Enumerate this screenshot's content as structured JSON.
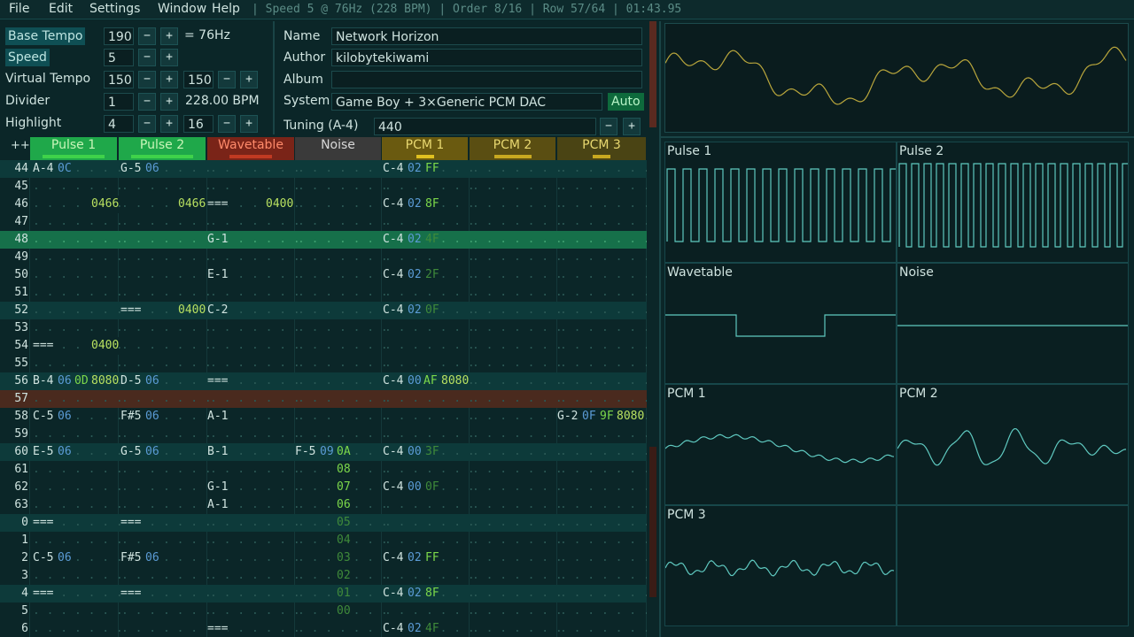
{
  "menu": {
    "items": [
      "File",
      "Edit",
      "Settings",
      "Window",
      "Help"
    ],
    "status": "| Speed 5 @ 76Hz (228 BPM) | Order 8/16 | Row 57/64 | 01:43.95"
  },
  "speed_panel": {
    "base_tempo_label": "Base Tempo",
    "base_tempo_value": "190",
    "base_tempo_hz": "= 76Hz",
    "speed_label": "Speed",
    "speed_value": "5",
    "virtual_tempo_label": "Virtual Tempo",
    "virtual_tempo_num": "150",
    "virtual_tempo_den": "150",
    "divider_label": "Divider",
    "divider_value": "1",
    "bpm": "228.00 BPM",
    "highlight_label": "Highlight",
    "highlight_a": "4",
    "highlight_b": "16",
    "minus": "−",
    "plus": "+"
  },
  "song_info": {
    "name_label": "Name",
    "name_value": "Network Horizon",
    "author_label": "Author",
    "author_value": "kilobytekiwami",
    "album_label": "Album",
    "album_value": "",
    "system_label": "System",
    "system_value": "Game Boy + 3×Generic PCM DAC",
    "auto_label": "Auto",
    "tuning_label": "Tuning (A-4)",
    "tuning_value": "440"
  },
  "channels": [
    {
      "name": "Pulse 1",
      "color": "#1fa84a",
      "bar": "#3fd24a"
    },
    {
      "name": "Pulse 2",
      "color": "#1fa84a",
      "bar": "#3fd24a"
    },
    {
      "name": "Wavetable",
      "color": "#7a2418",
      "bar": "#c03a22"
    },
    {
      "name": "Noise",
      "color": "#3a3a3a",
      "bar": "#6a6a6a"
    },
    {
      "name": "PCM 1",
      "color": "#6a5a10",
      "bar": "#e0c020"
    },
    {
      "name": "PCM 2",
      "color": "#5a4e12",
      "bar": "#c8a820"
    },
    {
      "name": "PCM 3",
      "color": "#4a4414",
      "bar": "#c8a820"
    }
  ],
  "pattern_header_plus": "++",
  "pattern_rows": [
    {
      "num": "44",
      "hl": true
    },
    {
      "num": "45"
    },
    {
      "num": "46"
    },
    {
      "num": "47"
    },
    {
      "num": "48",
      "hl": true,
      "cur": true
    },
    {
      "num": "49"
    },
    {
      "num": "50"
    },
    {
      "num": "51"
    },
    {
      "num": "52",
      "hl": true
    },
    {
      "num": "53"
    },
    {
      "num": "54"
    },
    {
      "num": "55"
    },
    {
      "num": "56",
      "hl": true
    },
    {
      "num": "57",
      "edit": true
    },
    {
      "num": "58"
    },
    {
      "num": "59"
    },
    {
      "num": "60",
      "hl": true
    },
    {
      "num": "61"
    },
    {
      "num": "62"
    },
    {
      "num": "63"
    },
    {
      "num": "0",
      "hl": true
    },
    {
      "num": "1"
    },
    {
      "num": "2"
    },
    {
      "num": "3"
    },
    {
      "num": "4",
      "hl": true
    },
    {
      "num": "5"
    },
    {
      "num": "6"
    }
  ],
  "pattern_cells": [
    [
      [
        "A-4",
        "n"
      ],
      [
        "0C",
        "i"
      ],
      [
        "...........",
        "d"
      ],
      [
        "G-5",
        "n"
      ],
      [
        "06",
        "i"
      ],
      [
        "...............................................",
        "d"
      ],
      [
        "C-4",
        "n"
      ],
      [
        "02",
        "i"
      ],
      [
        "FF",
        "v"
      ]
    ],
    [],
    [
      [
        "........",
        "d"
      ],
      [
        "0466",
        "fx"
      ],
      [
        "........",
        "d"
      ],
      [
        "0466",
        "fx"
      ],
      [
        "===",
        "n"
      ],
      [
        "........",
        "d"
      ],
      [
        "0400",
        "fx"
      ],
      [
        "...............",
        "d"
      ],
      [
        "C-4",
        "n"
      ],
      [
        "02",
        "i"
      ],
      [
        "8F",
        "v"
      ]
    ],
    [],
    [
      [
        "...............................",
        "d"
      ],
      [
        "G-1",
        "n"
      ],
      [
        ".....................",
        "d"
      ],
      [
        "C-4",
        "n"
      ],
      [
        "02",
        "i"
      ],
      [
        "4F",
        "vd"
      ]
    ],
    [],
    [
      [
        "...............................",
        "d"
      ],
      [
        "E-1",
        "n"
      ],
      [
        ".....................",
        "d"
      ],
      [
        "C-4",
        "n"
      ],
      [
        "02",
        "i"
      ],
      [
        "2F",
        "vd"
      ]
    ],
    [],
    [
      [
        "...............",
        "d"
      ],
      [
        "===",
        "n"
      ],
      [
        "......",
        "d"
      ],
      [
        "0400",
        "fx"
      ],
      [
        "C-2",
        "n"
      ],
      [
        ".....................",
        "d"
      ],
      [
        "C-4",
        "n"
      ],
      [
        "02",
        "i"
      ],
      [
        "0F",
        "vd"
      ]
    ],
    [],
    [
      [
        "===",
        "n"
      ],
      [
        ".....",
        "d"
      ],
      [
        "0400",
        "fx"
      ]
    ],
    [],
    [
      [
        "B-4",
        "n"
      ],
      [
        "06",
        "i"
      ],
      [
        "0D",
        "v"
      ],
      [
        "8080",
        "fx"
      ],
      [
        "D-5",
        "n"
      ],
      [
        "06",
        "i"
      ],
      [
        "........",
        "d"
      ],
      [
        "===",
        "n"
      ],
      [
        "...................",
        "d"
      ],
      [
        "C-4",
        "n"
      ],
      [
        "00",
        "i"
      ],
      [
        "AF",
        "v"
      ],
      [
        "8080",
        "fx"
      ]
    ],
    [],
    [
      [
        "C-5",
        "n"
      ],
      [
        "06",
        "i"
      ],
      [
        "........",
        "d"
      ],
      [
        "F#5",
        "n"
      ],
      [
        "06",
        "i"
      ],
      [
        "........",
        "d"
      ],
      [
        "A-1",
        "n"
      ],
      [
        "........................................",
        "d"
      ],
      [
        "G-2",
        "n"
      ],
      [
        "0F",
        "i"
      ],
      [
        "9F",
        "v"
      ],
      [
        "8080",
        "fx"
      ]
    ],
    [],
    [
      [
        "E-5",
        "n"
      ],
      [
        "06",
        "i"
      ],
      [
        "........",
        "d"
      ],
      [
        "G-5",
        "n"
      ],
      [
        "06",
        "i"
      ],
      [
        "........",
        "d"
      ],
      [
        "B-1",
        "n"
      ],
      [
        "........",
        "d"
      ],
      [
        "F-5",
        "n"
      ],
      [
        "09",
        "i"
      ],
      [
        "0A",
        "v"
      ],
      [
        "C-4",
        "n"
      ],
      [
        "00",
        "i"
      ],
      [
        "3F",
        "vd"
      ]
    ],
    [
      [
        "08",
        "v"
      ]
    ],
    [
      [
        "G-1",
        "n"
      ],
      [
        "07",
        "v"
      ],
      [
        "C-4",
        "n"
      ],
      [
        "00",
        "i"
      ],
      [
        "0F",
        "vd"
      ]
    ],
    [
      [
        "A-1",
        "n"
      ],
      [
        "06",
        "v"
      ]
    ],
    [
      [
        "===",
        "n"
      ],
      [
        "........",
        "d"
      ],
      [
        "===",
        "n"
      ],
      [
        "05",
        "vd"
      ]
    ],
    [
      [
        "04",
        "vd"
      ]
    ],
    [
      [
        "C-5",
        "n"
      ],
      [
        "06",
        "i"
      ],
      [
        "F#5",
        "n"
      ],
      [
        "06",
        "i"
      ],
      [
        "03",
        "vd"
      ],
      [
        "C-4",
        "n"
      ],
      [
        "02",
        "i"
      ],
      [
        "FF",
        "v"
      ]
    ],
    [
      [
        "02",
        "vd"
      ]
    ],
    [
      [
        "===",
        "n"
      ],
      [
        "........",
        "d"
      ],
      [
        "===",
        "n"
      ],
      [
        "01",
        "vd"
      ],
      [
        "C-4",
        "n"
      ],
      [
        "02",
        "i"
      ],
      [
        "8F",
        "v"
      ]
    ],
    [
      [
        "00",
        "vd"
      ]
    ],
    [
      [
        "===",
        "n"
      ],
      [
        "C-4",
        "n"
      ],
      [
        "02",
        "i"
      ],
      [
        "4F",
        "vd"
      ]
    ]
  ],
  "osc_channels": [
    "Pulse 1",
    "Pulse 2",
    "Wavetable",
    "Noise",
    "PCM 1",
    "PCM 2",
    "PCM 3"
  ]
}
